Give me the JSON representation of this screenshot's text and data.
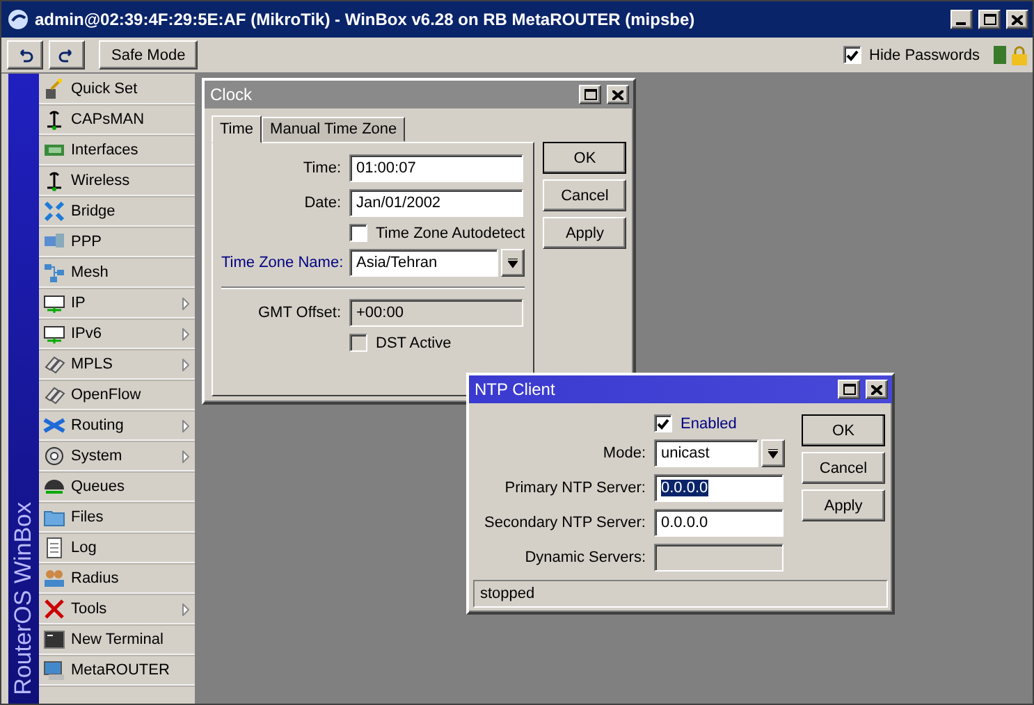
{
  "window": {
    "title": "admin@02:39:4F:29:5E:AF (MikroTik) - WinBox v6.28 on RB MetaROUTER (mipsbe)"
  },
  "toolbar": {
    "safe_mode": "Safe Mode",
    "hide_passwords": {
      "label": "Hide Passwords",
      "checked": true
    }
  },
  "sidebar": {
    "brand": "RouterOS WinBox",
    "items": [
      {
        "label": "Quick Set",
        "has_submenu": false
      },
      {
        "label": "CAPsMAN",
        "has_submenu": false
      },
      {
        "label": "Interfaces",
        "has_submenu": false
      },
      {
        "label": "Wireless",
        "has_submenu": false
      },
      {
        "label": "Bridge",
        "has_submenu": false
      },
      {
        "label": "PPP",
        "has_submenu": false
      },
      {
        "label": "Mesh",
        "has_submenu": false
      },
      {
        "label": "IP",
        "has_submenu": true
      },
      {
        "label": "IPv6",
        "has_submenu": true
      },
      {
        "label": "MPLS",
        "has_submenu": true
      },
      {
        "label": "OpenFlow",
        "has_submenu": false
      },
      {
        "label": "Routing",
        "has_submenu": true
      },
      {
        "label": "System",
        "has_submenu": true
      },
      {
        "label": "Queues",
        "has_submenu": false
      },
      {
        "label": "Files",
        "has_submenu": false
      },
      {
        "label": "Log",
        "has_submenu": false
      },
      {
        "label": "Radius",
        "has_submenu": false
      },
      {
        "label": "Tools",
        "has_submenu": true
      },
      {
        "label": "New Terminal",
        "has_submenu": false
      },
      {
        "label": "MetaROUTER",
        "has_submenu": false
      }
    ]
  },
  "clock": {
    "title": "Clock",
    "active": false,
    "tabs": [
      {
        "label": "Time",
        "selected": true
      },
      {
        "label": "Manual Time Zone",
        "selected": false
      }
    ],
    "time": {
      "label": "Time:",
      "value": "01:00:07"
    },
    "date": {
      "label": "Date:",
      "value": "Jan/01/2002"
    },
    "autodetect": {
      "label": "Time Zone Autodetect",
      "checked": false,
      "disabled": false
    },
    "timezone": {
      "label": "Time Zone Name:",
      "value": "Asia/Tehran",
      "highlighted": true
    },
    "gmt": {
      "label": "GMT Offset:",
      "value": "+00:00"
    },
    "dst": {
      "label": "DST Active",
      "checked": false,
      "disabled": true
    },
    "buttons": [
      {
        "label": "OK",
        "default": true
      },
      {
        "label": "Cancel",
        "default": false
      },
      {
        "label": "Apply",
        "default": false
      }
    ]
  },
  "ntp": {
    "title": "NTP Client",
    "active": true,
    "enabled": {
      "label": "Enabled",
      "checked": true,
      "highlighted": true
    },
    "mode": {
      "label": "Mode:",
      "value": "unicast"
    },
    "primary": {
      "label": "Primary NTP Server:",
      "value": "0.0.0.0",
      "selected": true
    },
    "secondary": {
      "label": "Secondary NTP Server:",
      "value": "0.0.0.0",
      "selected": false
    },
    "dynamic": {
      "label": "Dynamic Servers:"
    },
    "status": "stopped",
    "buttons": [
      {
        "label": "OK",
        "default": true
      },
      {
        "label": "Cancel",
        "default": false
      },
      {
        "label": "Apply",
        "default": false
      }
    ]
  }
}
